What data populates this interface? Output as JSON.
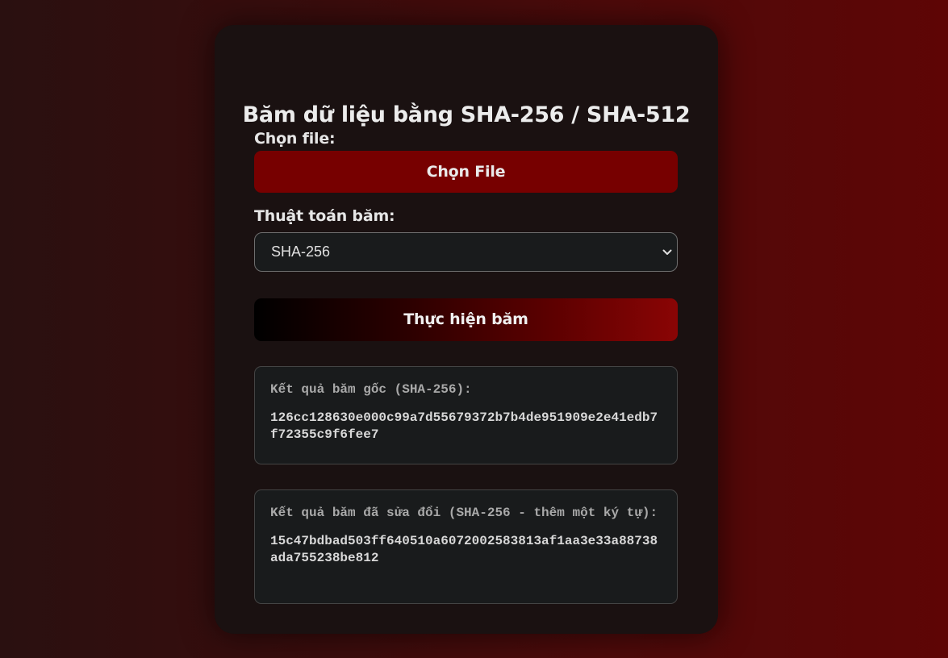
{
  "page": {
    "title": "Băm dữ liệu bằng SHA-256 / SHA-512"
  },
  "file": {
    "label": "Chọn file:",
    "button": "Chọn File"
  },
  "algorithm": {
    "label": "Thuật toán băm:",
    "selected": "SHA-256"
  },
  "actions": {
    "hash_button": "Thực hiện băm"
  },
  "results": {
    "original": {
      "title": "Kết quả băm gốc (SHA-256):",
      "value": "126cc128630e000c99a7d55679372b7b4de951909e2e41edb7f72355c9f6fee7"
    },
    "modified": {
      "title": "Kết quả băm đã sửa đổi (SHA-256 - thêm một ký tự):",
      "value": "15c47bdbad503ff640510a6072002583813af1aa3e33a88738ada755238be812"
    }
  },
  "colors": {
    "primary_button": "#770000",
    "card_background": "#1a1111",
    "field_background": "#191b1c"
  },
  "icons": {
    "select_arrow": "chevron-down-icon"
  }
}
